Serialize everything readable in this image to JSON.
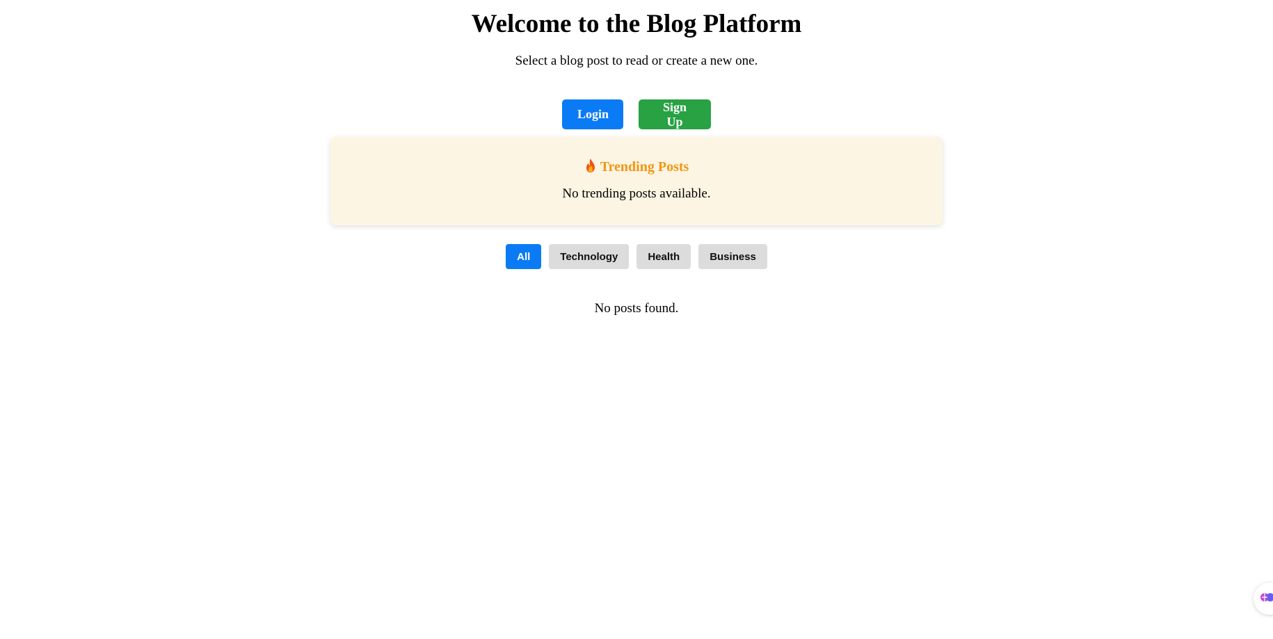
{
  "header": {
    "title": "Welcome to the Blog Platform",
    "subtitle": "Select a blog post to read or create a new one."
  },
  "auth": {
    "login_label": "Login",
    "signup_label": "Sign Up"
  },
  "trending": {
    "icon": "fire-icon",
    "title": "Trending Posts",
    "empty_message": "No trending posts available."
  },
  "filters": {
    "selected": "All",
    "items": [
      {
        "label": "All"
      },
      {
        "label": "Technology"
      },
      {
        "label": "Health"
      },
      {
        "label": "Business"
      }
    ]
  },
  "posts": {
    "empty_message": "No posts found."
  },
  "floating": {
    "icon": "assistant-icon"
  },
  "colors": {
    "primary": "#0a7bf5",
    "success": "#28a243",
    "trending_accent": "#f29613",
    "trending_bg": "#fdf5e3",
    "chip_bg": "#dcdcdc"
  }
}
